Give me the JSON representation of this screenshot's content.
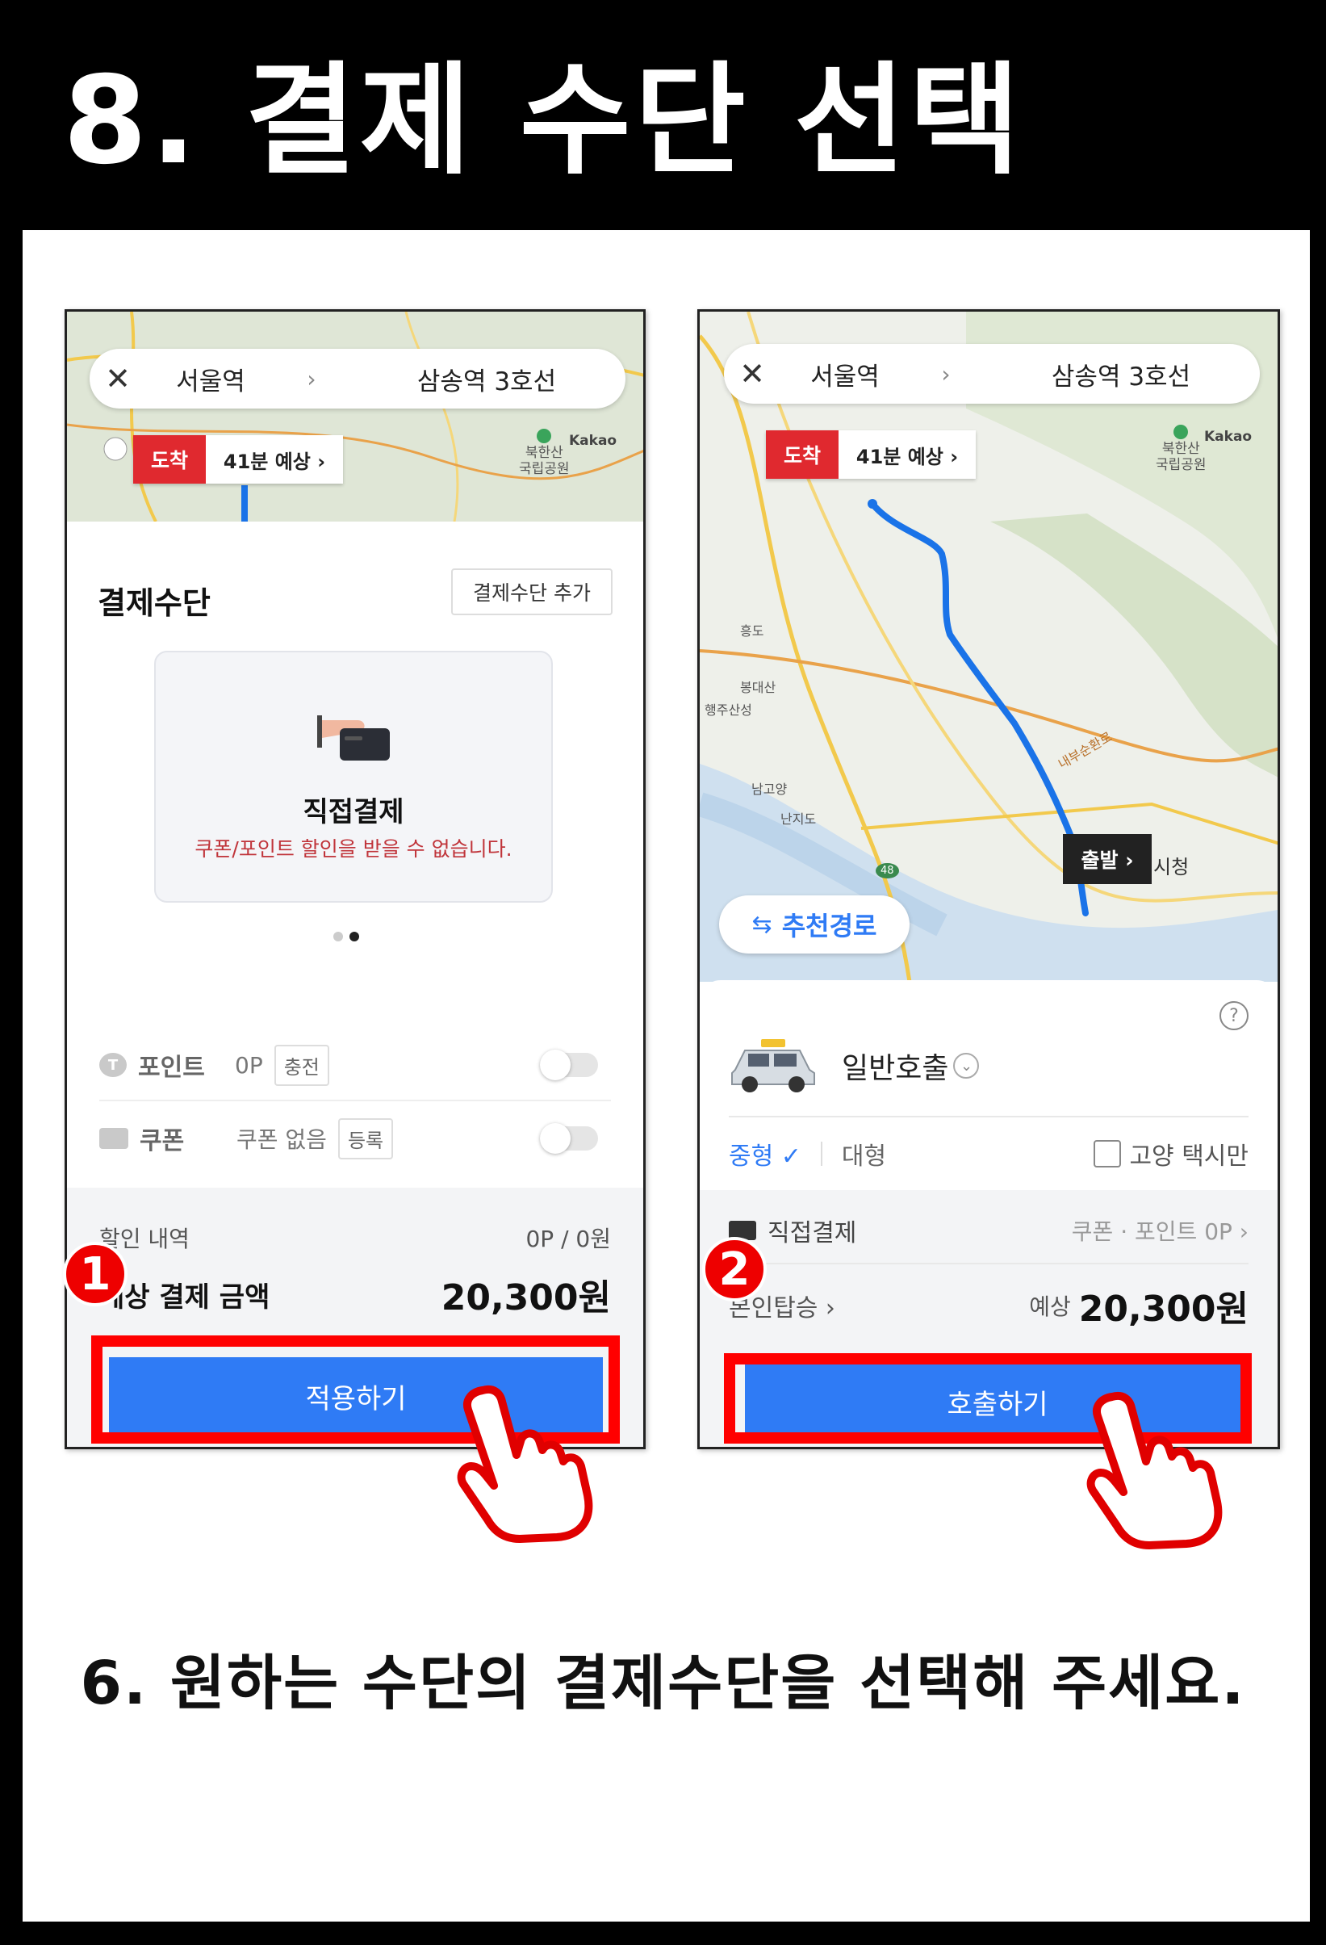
{
  "header": {
    "title": "8. 결제 수단 선택"
  },
  "caption": "6. 원하는 수단의 결제수단을 선택해 주세요.",
  "colors": {
    "accent_blue": "#2f7bf5",
    "highlight_red": "#ff0000",
    "arrive_red": "#e0292f"
  },
  "left_phone": {
    "route": {
      "close_icon": "close-icon",
      "from": "서울역",
      "arrow": "›",
      "to": "삼송역 3호선"
    },
    "arrive": {
      "label": "도착",
      "eta": "41분 예상 ›"
    },
    "park": {
      "name": "북한산\n국립공원",
      "brand": "Kakao"
    },
    "sheet": {
      "title": "결제수단",
      "add_button": "결제수단 추가",
      "card": {
        "name": "직접결제",
        "note": "쿠폰/포인트 할인을 받을 수 없습니다."
      },
      "point": {
        "label": "포인트",
        "value": "0P",
        "button": "충전"
      },
      "coupon": {
        "label": "쿠폰",
        "value": "쿠폰 없음",
        "button": "등록"
      },
      "discount": {
        "label": "할인 내역",
        "value": "0P / 0원"
      },
      "total": {
        "label": "예상 결제 금액",
        "value": "20,300원"
      },
      "apply_button": "적용하기"
    },
    "badge": "1"
  },
  "right_phone": {
    "route": {
      "close_icon": "close-icon",
      "from": "서울역",
      "arrow": "›",
      "to": "삼송역 3호선"
    },
    "arrive": {
      "label": "도착",
      "eta": "41분 예상 ›"
    },
    "park": {
      "name": "북한산\n국립공원",
      "brand": "Kakao"
    },
    "map_labels": {
      "ic1": "흥도",
      "ic2": "봉대산",
      "area1": "행주산성",
      "ic3": "남고양",
      "area2": "난지도",
      "road": "내부순환로",
      "route_no": "48"
    },
    "depart": "출발 ›",
    "cityhall": "시청",
    "recommend": "추천경로",
    "taxi": {
      "name": "일반호출",
      "help": "?"
    },
    "sizes": {
      "selected": "중형 ✓",
      "other": "대형",
      "checkbox": "고양 택시만"
    },
    "payment": {
      "method": "직접결제",
      "right": "쿠폰 · 포인트 0P ›"
    },
    "self_ride": "본인탑승 ›",
    "estimate": {
      "label": "예상",
      "value": "20,300원"
    },
    "call_button": "호출하기",
    "badge": "2"
  }
}
